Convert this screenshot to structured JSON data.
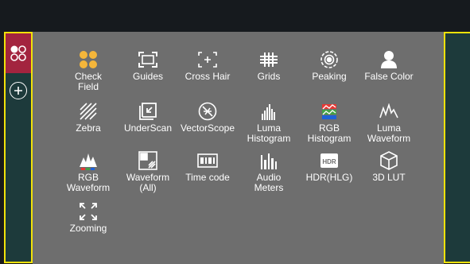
{
  "menu": {
    "tiles": [
      {
        "label": "Check\nField",
        "icon": "check-field-icon"
      },
      {
        "label": "Guides",
        "icon": "guides-icon"
      },
      {
        "label": "Cross Hair",
        "icon": "cross-hair-icon"
      },
      {
        "label": "Grids",
        "icon": "grids-icon"
      },
      {
        "label": "Peaking",
        "icon": "peaking-icon"
      },
      {
        "label": "False Color",
        "icon": "false-color-icon"
      },
      {
        "label": "Zebra",
        "icon": "zebra-icon"
      },
      {
        "label": "UnderScan",
        "icon": "underscan-icon"
      },
      {
        "label": "VectorScope",
        "icon": "vectorscope-icon"
      },
      {
        "label": "Luma\nHistogram",
        "icon": "luma-histogram-icon"
      },
      {
        "label": "RGB\nHistogram",
        "icon": "rgb-histogram-icon"
      },
      {
        "label": "Luma\nWaveform",
        "icon": "luma-waveform-icon"
      },
      {
        "label": "RGB\nWaveform",
        "icon": "rgb-waveform-icon"
      },
      {
        "label": "Waveform\n(All)",
        "icon": "waveform-all-icon"
      },
      {
        "label": "Time code",
        "icon": "time-code-icon"
      },
      {
        "label": "Audio\nMeters",
        "icon": "audio-meters-icon"
      },
      {
        "label": "HDR(HLG)",
        "icon": "hdr-hlg-icon"
      },
      {
        "label": "3D LUT",
        "icon": "3d-lut-icon"
      },
      {
        "label": "Zooming",
        "icon": "zooming-icon"
      }
    ]
  },
  "left_panel": {
    "active_icon": "four-circles-icon",
    "add_icon": "plus-circle-icon"
  },
  "colors": {
    "accent_active": "#a3243f",
    "highlight_border": "#f2e20a",
    "check_field": "#f5b63a",
    "panel_bg": "#6e6e6e"
  }
}
